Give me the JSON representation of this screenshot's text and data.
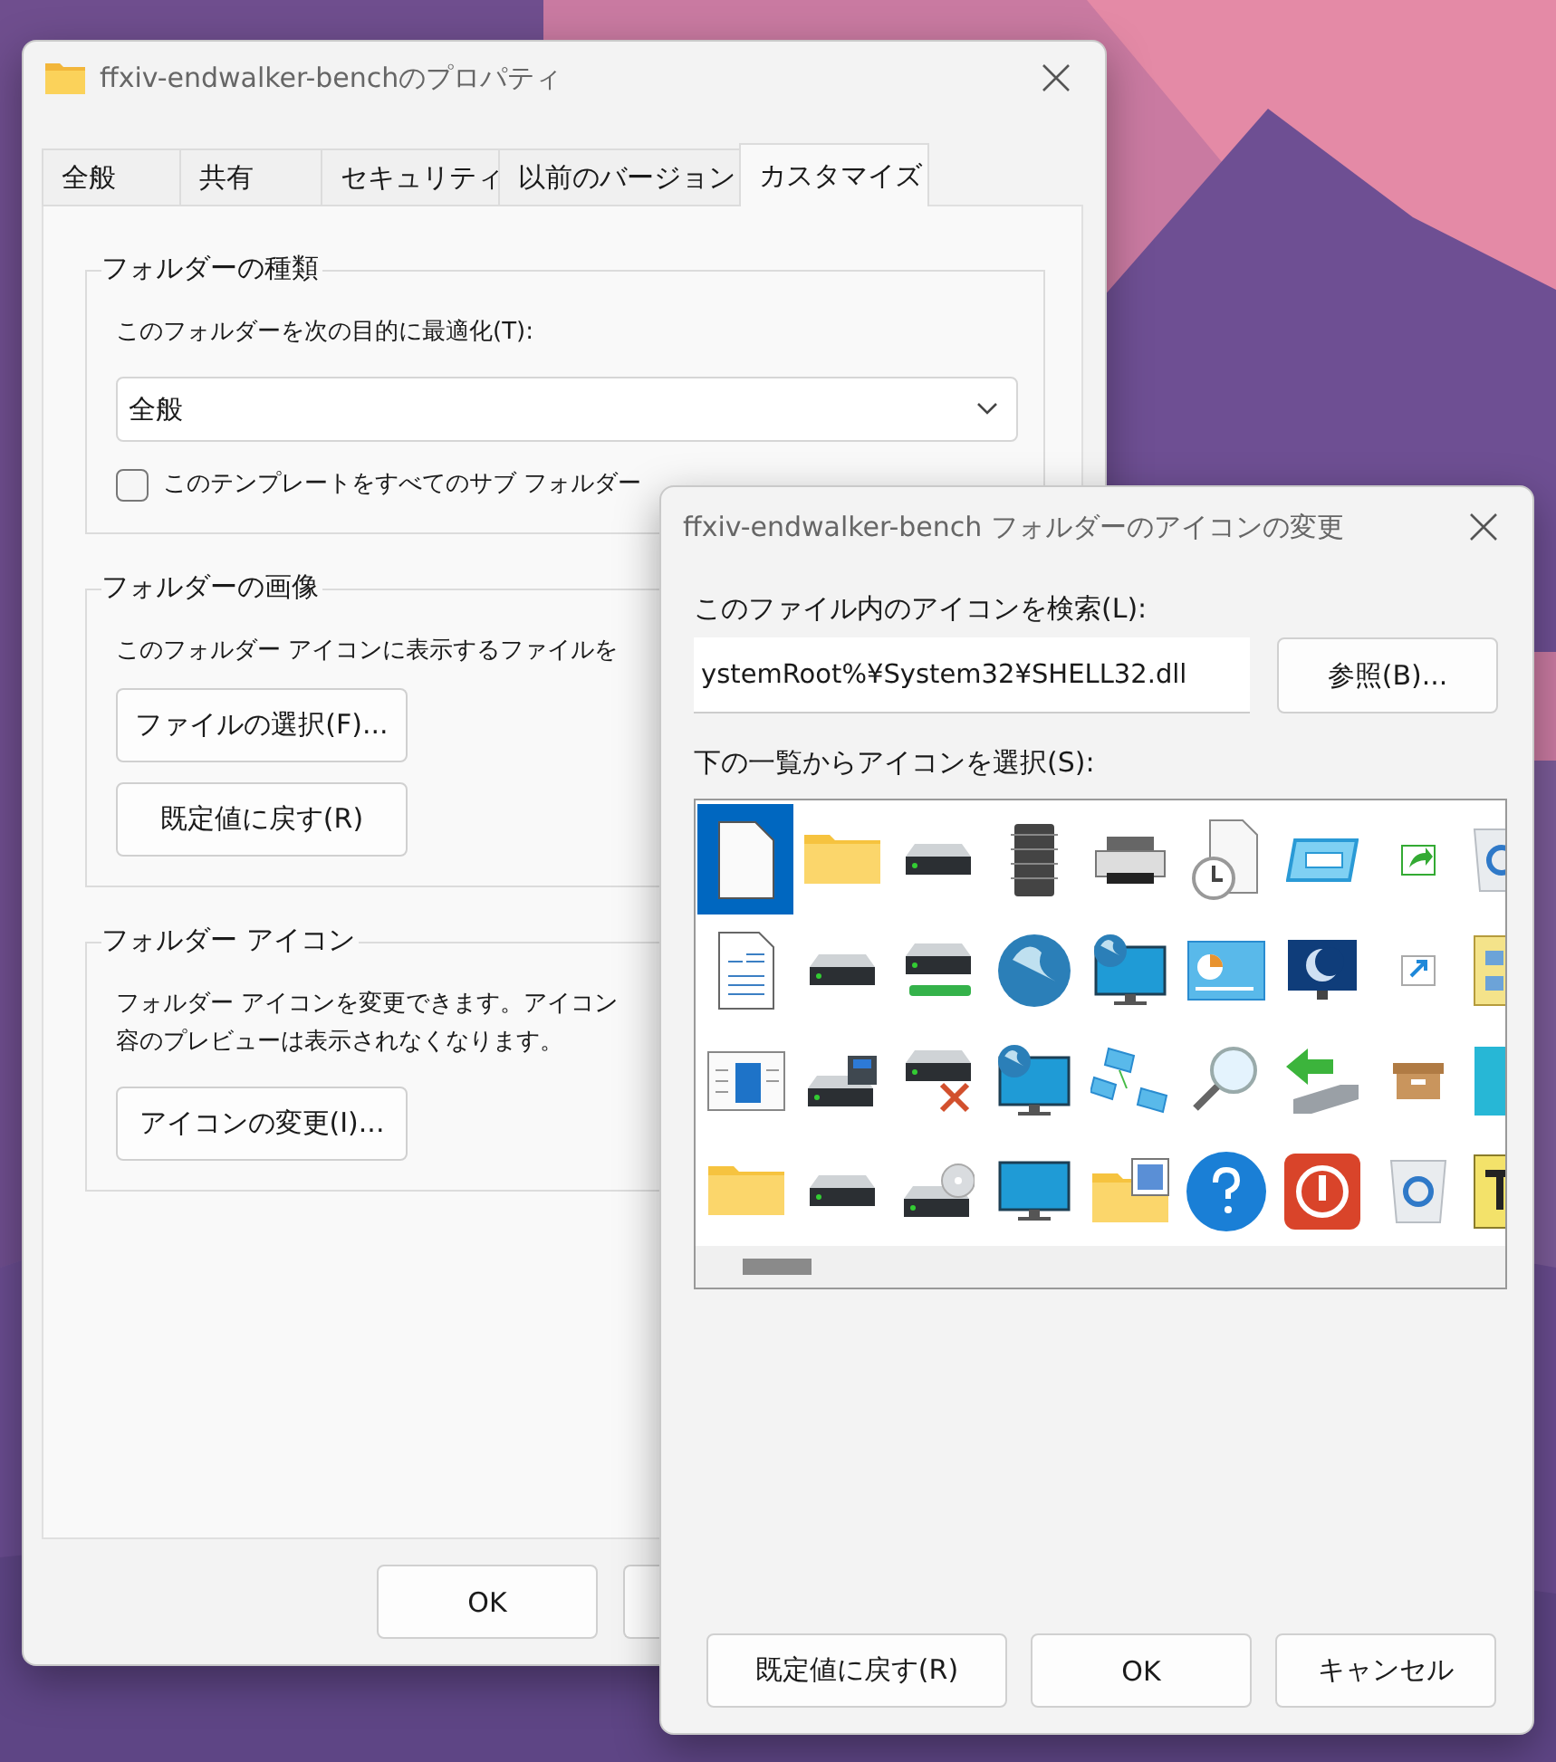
{
  "properties_window": {
    "title": "ffxiv-endwalker-benchのプロパティ",
    "tabs": [
      {
        "label": "全般",
        "selected": false
      },
      {
        "label": "共有",
        "selected": false
      },
      {
        "label": "セキュリティ",
        "selected": false
      },
      {
        "label": "以前のバージョン",
        "selected": false
      },
      {
        "label": "カスタマイズ",
        "selected": true
      }
    ],
    "folder_type": {
      "heading": "フォルダーの種類",
      "label": "このフォルダーを次の目的に最適化(T):",
      "dropdown_value": "全般",
      "checkbox": {
        "label": "このテンプレートをすべてのサブ フォルダー",
        "checked": false
      }
    },
    "folder_picture": {
      "heading": "フォルダーの画像",
      "text": "このフォルダー アイコンに表示するファイルを",
      "buttons": [
        "ファイルの選択(F)...",
        "既定値に戻す(R)"
      ]
    },
    "folder_icon": {
      "heading": "フォルダー アイコン",
      "lines": [
        "フォルダー アイコンを変更できます。アイコン",
        "容のプレビューは表示されなくなります。"
      ],
      "button": "アイコンの変更(I)..."
    },
    "buttons": [
      "OK"
    ]
  },
  "change_icon_dialog": {
    "title": "ffxiv-endwalker-bench フォルダーのアイコンの変更",
    "file_label": "このファイル内のアイコンを検索(L):",
    "file_value": "ystemRoot%¥System32¥SHELL32.dll",
    "browse_button": "参照(B)...",
    "list_label": "下の一覧からアイコンを選択(S):",
    "icons": [
      {
        "kind": "document",
        "selected": true
      },
      {
        "kind": "folder",
        "selected": false
      },
      {
        "kind": "drive",
        "selected": false
      },
      {
        "kind": "chip",
        "selected": false
      },
      {
        "kind": "printer",
        "selected": false
      },
      {
        "kind": "clock",
        "selected": false
      },
      {
        "kind": "window",
        "selected": false
      },
      {
        "kind": "share",
        "selected": false
      },
      {
        "kind": "bin",
        "selected": false
      },
      {
        "kind": "textdoc",
        "selected": false
      },
      {
        "kind": "drive",
        "selected": false
      },
      {
        "kind": "netdrive",
        "selected": false
      },
      {
        "kind": "globe",
        "selected": false
      },
      {
        "kind": "globemonitor",
        "selected": false
      },
      {
        "kind": "panel",
        "selected": false
      },
      {
        "kind": "moon",
        "selected": false
      },
      {
        "kind": "link",
        "selected": false
      },
      {
        "kind": "yellowdoc",
        "selected": false
      },
      {
        "kind": "sidebar",
        "selected": false
      },
      {
        "kind": "floppy",
        "selected": false
      },
      {
        "kind": "baddrive",
        "selected": false
      },
      {
        "kind": "globemonitor",
        "selected": false
      },
      {
        "kind": "network",
        "selected": false
      },
      {
        "kind": "search",
        "selected": false
      },
      {
        "kind": "usb",
        "selected": false
      },
      {
        "kind": "box",
        "selected": false
      },
      {
        "kind": "tile",
        "selected": false
      },
      {
        "kind": "folder",
        "selected": false
      },
      {
        "kind": "drive",
        "selected": false
      },
      {
        "kind": "disc",
        "selected": false
      },
      {
        "kind": "monitor",
        "selected": false
      },
      {
        "kind": "gridfolder",
        "selected": false
      },
      {
        "kind": "help",
        "selected": false
      },
      {
        "kind": "power",
        "selected": false
      },
      {
        "kind": "bin",
        "selected": false
      },
      {
        "kind": "tools",
        "selected": false
      }
    ],
    "buttons": [
      "既定値に戻す(R)",
      "OK",
      "キャンセル"
    ]
  }
}
